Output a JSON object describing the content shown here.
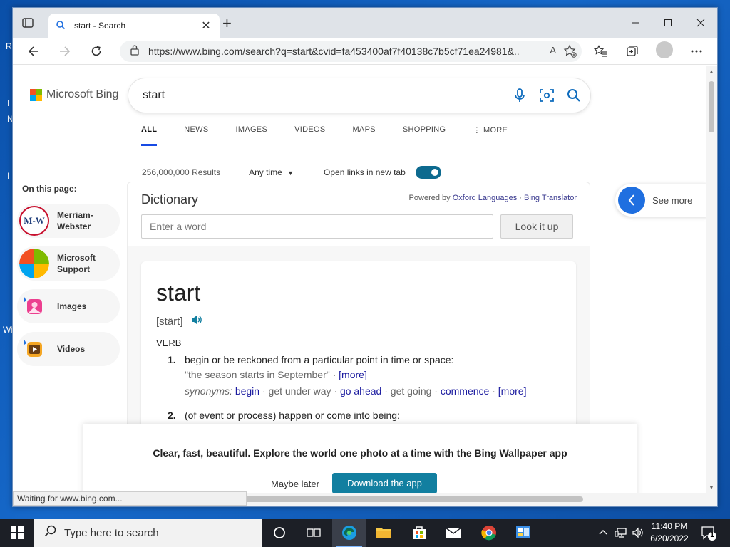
{
  "desktop": {
    "glyphs": [
      "R",
      "I",
      "N",
      "I",
      "Wi"
    ]
  },
  "browser": {
    "tab_title": "start - Search",
    "address_url": "https://www.bing.com/search?q=start&cvid=fa453400af7f40138c7b5cf71ea24981&...",
    "read_aloud": "A",
    "status_text": "Waiting for www.bing.com..."
  },
  "bing": {
    "logo_text": "Microsoft Bing",
    "query": "start",
    "tabs": [
      "ALL",
      "NEWS",
      "IMAGES",
      "VIDEOS",
      "MAPS",
      "SHOPPING",
      "MORE"
    ],
    "more_prefix": "⋮",
    "results_count": "256,000,000 Results",
    "any_time": "Any time",
    "open_new_tab_label": "Open links in new tab",
    "open_new_tab_enabled": true,
    "on_this_page": "On this page:",
    "on_this_page_items": [
      {
        "label": "Merriam-Webster",
        "icon": "mw-icon",
        "icon_text": "M-W"
      },
      {
        "label": "Microsoft Support",
        "icon": "microsoft-icon"
      },
      {
        "label": "Images",
        "icon": "images-icon"
      },
      {
        "label": "Videos",
        "icon": "videos-icon"
      }
    ],
    "see_more": "See more"
  },
  "dictionary": {
    "title": "Dictionary",
    "powered_prefix": "Powered by",
    "provider": "Oxford Languages",
    "separator": "·",
    "translator": "Bing Translator",
    "input_placeholder": "Enter a word",
    "lookup_label": "Look it up",
    "word": "start",
    "pronunciation": "[stärt]",
    "part_of_speech": "VERB",
    "definitions": [
      {
        "num": "1.",
        "text": "begin or be reckoned from a particular point in time or space:",
        "example": "\"the season starts in September\"",
        "example_more": "[more]",
        "synonyms_label": "synonyms:",
        "synonyms": [
          "begin",
          "get under way",
          "go ahead",
          "get going",
          "commence"
        ],
        "synonyms_more": "[more]"
      },
      {
        "num": "2.",
        "text": "(of event or process) happen or come into being:"
      }
    ]
  },
  "banner": {
    "message": "Clear, fast, beautiful. Explore the world one photo at a time with the Bing Wallpaper app",
    "maybe_later": "Maybe later",
    "download": "Download the app"
  },
  "taskbar": {
    "search_placeholder": "Type here to search",
    "time": "11:40 PM",
    "date": "6/20/2022",
    "notification_count": "1"
  },
  "colors": {
    "accent_blue": "#174ae4",
    "toggle_teal": "#0d6a8f",
    "download_button": "#127fa0",
    "link": "#1a1a9f"
  }
}
